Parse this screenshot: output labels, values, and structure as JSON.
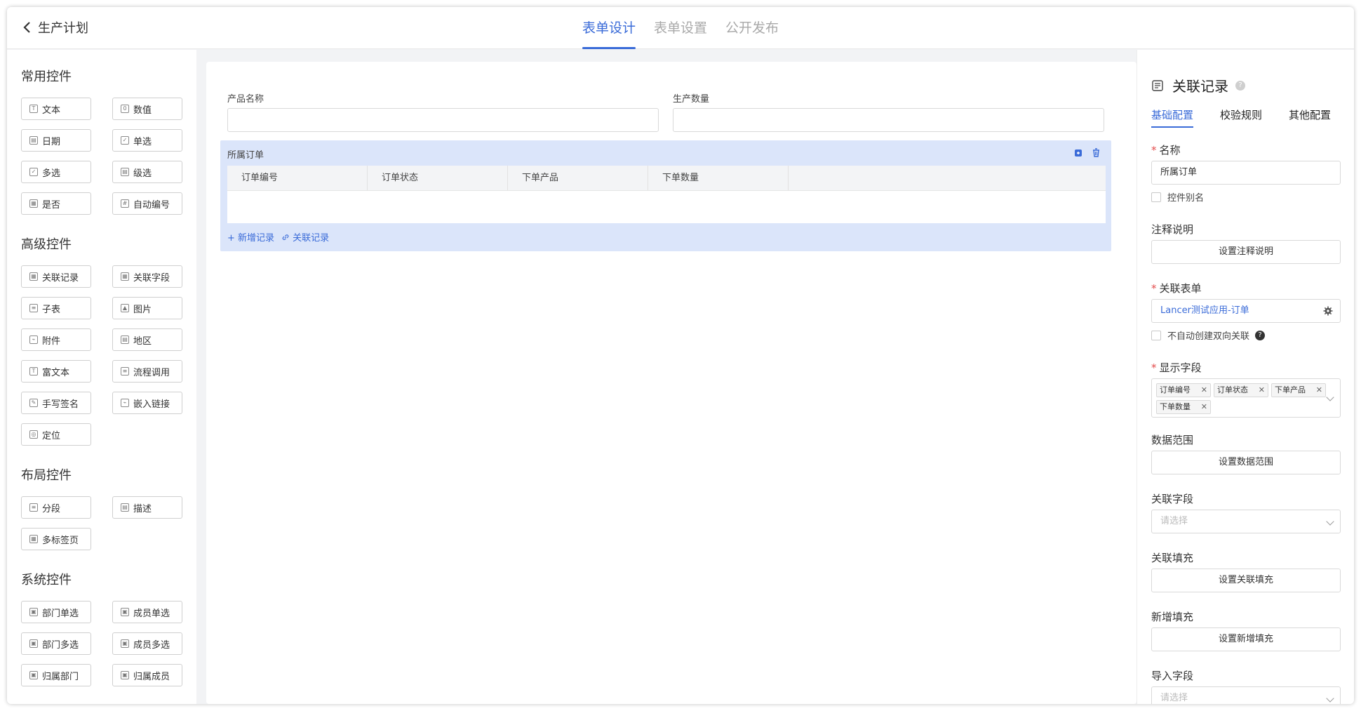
{
  "header": {
    "back_label": "生产计划",
    "tabs": [
      {
        "label": "表单设计",
        "active": true
      },
      {
        "label": "表单设置",
        "active": false
      },
      {
        "label": "公开发布",
        "active": false
      }
    ],
    "accent": "#3a6bd8"
  },
  "left": {
    "groups": [
      {
        "title": "常用控件",
        "items": [
          {
            "label": "文本",
            "icon": "text-icon"
          },
          {
            "label": "数值",
            "icon": "number-icon"
          },
          {
            "label": "日期",
            "icon": "date-icon"
          },
          {
            "label": "单选",
            "icon": "radio-icon"
          },
          {
            "label": "多选",
            "icon": "checkbox-icon"
          },
          {
            "label": "级选",
            "icon": "cascade-icon"
          },
          {
            "label": "是否",
            "icon": "yesno-icon"
          },
          {
            "label": "自动编号",
            "icon": "autonumber-icon"
          }
        ]
      },
      {
        "title": "高级控件",
        "items": [
          {
            "label": "关联记录",
            "icon": "link-record-icon"
          },
          {
            "label": "关联字段",
            "icon": "link-field-icon"
          },
          {
            "label": "子表",
            "icon": "subtable-icon"
          },
          {
            "label": "图片",
            "icon": "image-icon"
          },
          {
            "label": "附件",
            "icon": "attachment-icon"
          },
          {
            "label": "地区",
            "icon": "region-icon"
          },
          {
            "label": "富文本",
            "icon": "richtext-icon"
          },
          {
            "label": "流程调用",
            "icon": "flow-icon"
          },
          {
            "label": "手写签名",
            "icon": "signature-icon"
          },
          {
            "label": "嵌入链接",
            "icon": "embed-icon"
          },
          {
            "label": "定位",
            "icon": "location-icon"
          }
        ]
      },
      {
        "title": "布局控件",
        "items": [
          {
            "label": "分段",
            "icon": "section-icon"
          },
          {
            "label": "描述",
            "icon": "description-icon"
          },
          {
            "label": "多标签页",
            "icon": "tabs-icon"
          }
        ]
      },
      {
        "title": "系统控件",
        "items": [
          {
            "label": "部门单选",
            "icon": "dept-icon"
          },
          {
            "label": "成员单选",
            "icon": "member-icon"
          },
          {
            "label": "部门多选",
            "icon": "dept-icon"
          },
          {
            "label": "成员多选",
            "icon": "member-icon"
          },
          {
            "label": "归属部门",
            "icon": "dept-icon"
          },
          {
            "label": "归属成员",
            "icon": "member-icon"
          }
        ]
      }
    ]
  },
  "canvas": {
    "field1_label": "产品名称",
    "field2_label": "生产数量",
    "subform": {
      "title": "所属订单",
      "columns": [
        "订单编号",
        "订单状态",
        "下单产品",
        "下单数量"
      ],
      "add_label": "+ 新增记录",
      "link_label": "关联记录"
    }
  },
  "right": {
    "title": "关联记录",
    "tabs": [
      {
        "label": "基础配置",
        "active": true
      },
      {
        "label": "校验规则",
        "active": false
      },
      {
        "label": "其他配置",
        "active": false
      }
    ],
    "name_label": "名称",
    "name_value": "所属订单",
    "alias_label": "控件别名",
    "note_label": "注释说明",
    "note_btn": "设置注释说明",
    "form_label": "关联表单",
    "form_value": "Lancer测试应用-订单",
    "no_bidirectional": "不自动创建双向关联",
    "display_label": "显示字段",
    "display_tags": [
      "订单编号",
      "订单状态",
      "下单产品",
      "下单数量"
    ],
    "range_label": "数据范围",
    "range_btn": "设置数据范围",
    "link_field_label": "关联字段",
    "link_field_ph": "请选择",
    "link_fill_label": "关联填充",
    "link_fill_btn": "设置关联填充",
    "new_fill_label": "新增填充",
    "new_fill_btn": "设置新增填充",
    "import_label": "导入字段",
    "import_ph": "请选择"
  }
}
